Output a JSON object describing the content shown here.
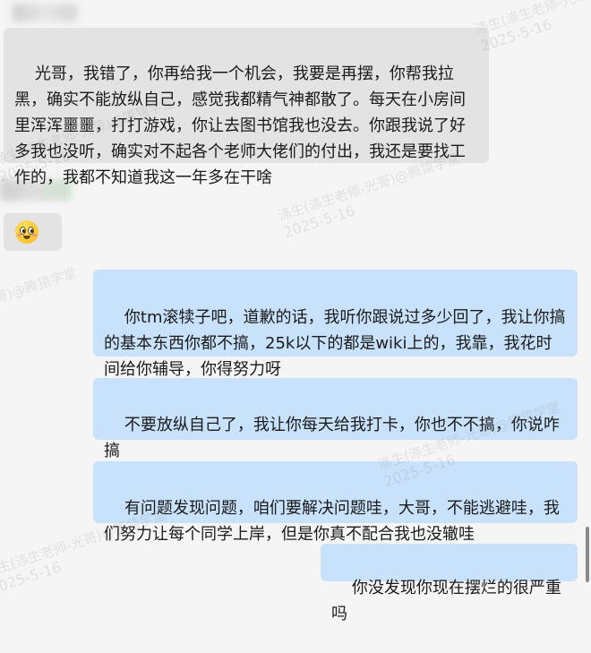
{
  "messages": [
    {
      "id": "msg-1",
      "direction": "incoming",
      "text": "光哥，我错了，你再给我一个机会，我要是再摆，你帮我拉黑，确实不能放纵自己，感觉我都精气神都散了。每天在小房间里浑浑噩噩，打打游戏，你让去图书馆我也没去。你跟我说了好多我也没听，确实对不起各个老师大佬们的付出，我还是要找工作的，我都不知道我这一年多在干啥"
    },
    {
      "id": "msg-2",
      "direction": "incoming",
      "emoji": "flushed-face-emoji"
    },
    {
      "id": "msg-3",
      "direction": "outgoing",
      "text": "你tm滚犊子吧，道歉的话，我听你跟说过多少回了，我让你搞的基本东西你都不搞，25k以下的都是wiki上的，我靠，我花时间给你辅导，你得努力呀"
    },
    {
      "id": "msg-4",
      "direction": "outgoing",
      "text": "不要放纵自己了，我让你每天给我打卡，你也不不搞，你说咋搞"
    },
    {
      "id": "msg-5",
      "direction": "outgoing",
      "text": "有问题发现问题，咱们要解决问题哇，大哥，不能逃避哇，我们努力让每个同学上岸，但是你真不配合我也没辙哇"
    },
    {
      "id": "msg-6",
      "direction": "outgoing",
      "text": "你没发现你现在摆烂的很严重吗"
    }
  ],
  "watermark": {
    "line1": "涤生(涤生老师-光哥)@腾猿学堂",
    "date": "2025-5-16"
  },
  "colors": {
    "background": "#f5f5f5",
    "incoming_bubble": "#e3e3e3",
    "outgoing_bubble": "#c8e2fb"
  }
}
